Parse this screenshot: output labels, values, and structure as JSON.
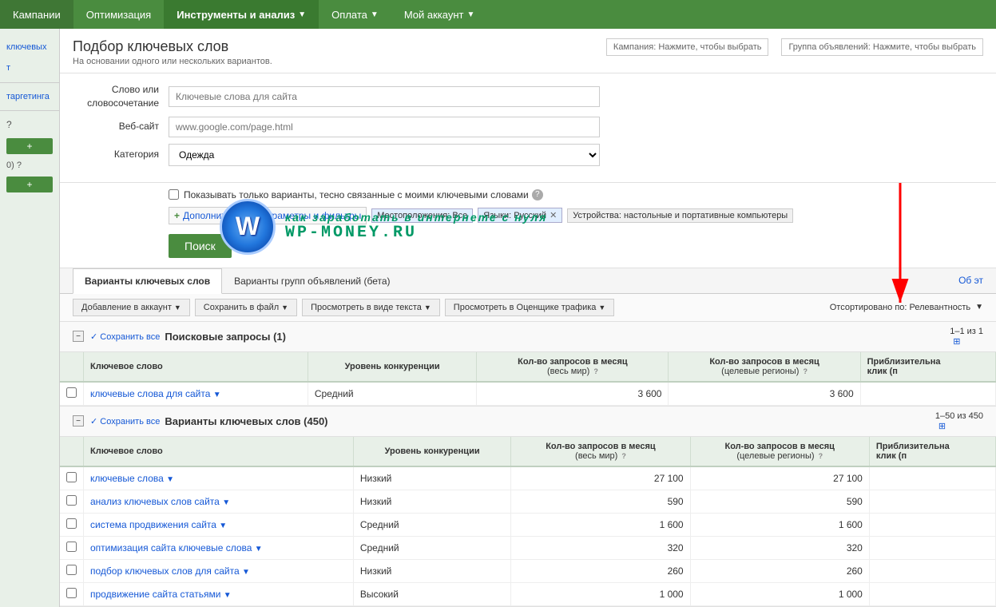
{
  "nav": {
    "items": [
      {
        "label": "Кампании",
        "active": false
      },
      {
        "label": "Оптимизация",
        "active": false
      },
      {
        "label": "Инструменты и анализ",
        "active": true,
        "hasArrow": true
      },
      {
        "label": "Оплата",
        "active": false,
        "hasArrow": true
      },
      {
        "label": "Мой аккаунт",
        "active": false,
        "hasArrow": true
      }
    ]
  },
  "sidebar": {
    "items": [
      {
        "label": "ключевых"
      },
      {
        "label": "т"
      },
      {
        "label": "таргетинга"
      }
    ],
    "question_mark": "?",
    "plus_btn": "+",
    "count_label": "0) ?",
    "plus_btn2": "+"
  },
  "page": {
    "title": "Подбор ключевых слов",
    "subtitle": "На основании одного или нескольких вариантов.",
    "campaign_label": "Кампания: Нажмите, чтобы выбрать",
    "adgroup_label": "Группа объявлений: Нажмите, чтобы выбрать"
  },
  "form": {
    "word_label": "Слово или\nсловосочетание",
    "word_placeholder": "Ключевые слова для сайта",
    "website_label": "Веб-сайт",
    "website_placeholder": "www.google.com/page.html",
    "category_label": "Категория",
    "category_value": "Одежда",
    "checkbox_label": "Показывать только варианты, тесно связанные с моими ключевыми словами",
    "filter_link": "Дополнительные параметры и фильтры",
    "location_tag": "Местоположения: Все",
    "language_tag": "Языки: Русский",
    "device_tag": "Устройства: настольные и портативные компьютеры",
    "search_btn": "Поиск"
  },
  "watermark": {
    "letter": "W",
    "line1": "как заработать в интернете с нуля",
    "line2": "WP-MONEY.RU"
  },
  "tabs": [
    {
      "label": "Варианты ключевых слов",
      "active": true
    },
    {
      "label": "Варианты групп объявлений (бета)",
      "active": false
    }
  ],
  "tab_link": "Об эт",
  "toolbar": {
    "add_to_account": "Добавление в аккаунт",
    "save_to_file": "Сохранить в файл",
    "view_text": "Просмотреть в виде текста",
    "view_traffic": "Просмотреть в Оценщике трафика",
    "sort_label": "Отсортировано по: Релевантность"
  },
  "search_queries": {
    "title": "Поисковые запросы (1)",
    "save_all": "✓ Сохранить все",
    "pagination": "1–1 из 1",
    "columns": [
      "Ключевое слово",
      "Уровень конкуренции",
      "Кол-во запросов в месяц\n(весь мир)",
      "Кол-во запросов в месяц\n(целевые регионы)",
      "Приблизительная\nклик (п"
    ],
    "rows": [
      {
        "keyword": "ключевые слова для сайта",
        "competition": "Средний",
        "global_monthly": "3 600",
        "local_monthly": "3 600",
        "approx_cpc": ""
      }
    ]
  },
  "keyword_variants": {
    "title": "Варианты ключевых слов (450)",
    "save_all": "✓ Сохранить все",
    "pagination": "1–50 из 450",
    "columns": [
      "Ключевое слово",
      "Уровень конкуренции",
      "Кол-во запросов в месяц\n(весь мир)",
      "Кол-во запросов в месяц\n(целевые регионы)",
      "Приблизительная\nклик (п"
    ],
    "rows": [
      {
        "keyword": "ключевые слова",
        "competition": "Низкий",
        "global_monthly": "27 100",
        "local_monthly": "27 100",
        "approx_cpc": ""
      },
      {
        "keyword": "анализ ключевых слов сайта",
        "competition": "Низкий",
        "global_monthly": "590",
        "local_monthly": "590",
        "approx_cpc": ""
      },
      {
        "keyword": "система продвижения сайта",
        "competition": "Средний",
        "global_monthly": "1 600",
        "local_monthly": "1 600",
        "approx_cpc": ""
      },
      {
        "keyword": "оптимизация сайта ключевые слова",
        "competition": "Средний",
        "global_monthly": "320",
        "local_monthly": "320",
        "approx_cpc": ""
      },
      {
        "keyword": "подбор ключевых слов для сайта",
        "competition": "Низкий",
        "global_monthly": "260",
        "local_monthly": "260",
        "approx_cpc": ""
      },
      {
        "keyword": "продвижение сайта статьями",
        "competition": "Высокий",
        "global_monthly": "1 000",
        "local_monthly": "1 000",
        "approx_cpc": ""
      }
    ]
  }
}
